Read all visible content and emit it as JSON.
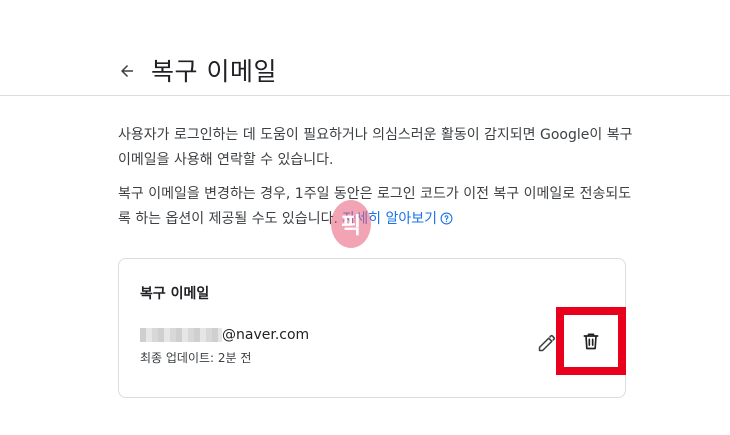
{
  "header": {
    "title": "복구 이메일"
  },
  "description": {
    "paragraph1": "사용자가 로그인하는 데 도움이 필요하거나 의심스러운 활동이 감지되면 Google이 복구 이메일을 사용해 연락할 수 있습니다.",
    "paragraph2": "복구 이메일을 변경하는 경우, 1주일 동안은 로그인 코드가 이전 복구 이메일로 전송되도록 하는 옵션이 제공될 수도 있습니다.",
    "learn_more": "자세히 알아보기"
  },
  "card": {
    "title": "복구 이메일",
    "email_visible": "@naver.com",
    "updated": "최종 업데이트: 2분 전"
  },
  "watermark": {
    "text": "픽"
  },
  "colors": {
    "link": "#1a73e8",
    "highlight": "#e8001c",
    "divider": "#dadce0"
  },
  "icons": {
    "back": "arrow-left-icon",
    "help": "help-circle-icon",
    "edit": "pencil-icon",
    "delete": "trash-icon"
  }
}
